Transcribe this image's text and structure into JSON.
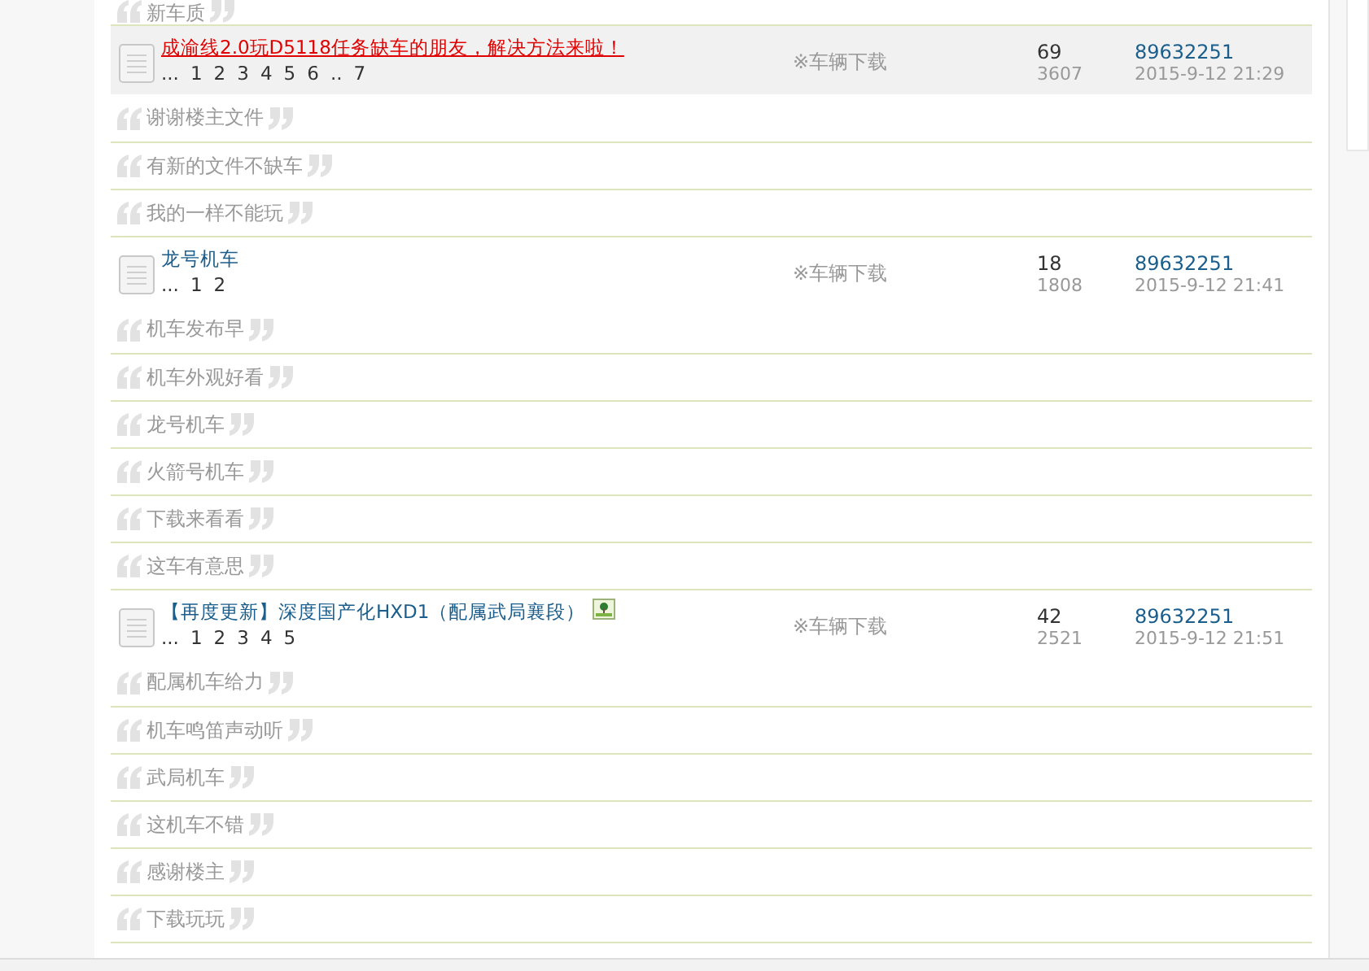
{
  "threads": [
    {
      "kind": "reply-only",
      "replies": [
        "新车质"
      ]
    },
    {
      "kind": "thread",
      "highlighted": true,
      "hot": true,
      "title": "成渝线2.0玩D5118任务缺车的朋友，解决方法来啦！",
      "has_image": false,
      "pages": [
        "...",
        "1",
        "2",
        "3",
        "4",
        "5",
        "6",
        "..",
        "7"
      ],
      "category": "※车辆下载",
      "replies_count": "69",
      "views": "3607",
      "author": "89632251",
      "date": "2015-9-12 21:29",
      "replies": [
        "谢谢楼主文件",
        "有新的文件不缺车",
        "我的一样不能玩"
      ]
    },
    {
      "kind": "thread",
      "highlighted": false,
      "hot": false,
      "title": "龙号机车",
      "has_image": false,
      "pages": [
        "...",
        "1",
        "2"
      ],
      "category": "※车辆下载",
      "replies_count": "18",
      "views": "1808",
      "author": "89632251",
      "date": "2015-9-12 21:41",
      "replies": [
        "机车发布早",
        "机车外观好看",
        "龙号机车",
        "火箭号机车",
        "下载来看看",
        "这车有意思"
      ]
    },
    {
      "kind": "thread",
      "highlighted": false,
      "hot": false,
      "prefix": "【再度更新】",
      "title": "深度国产化HXD1（配属武局襄段）",
      "has_image": true,
      "pages": [
        "...",
        "1",
        "2",
        "3",
        "4",
        "5"
      ],
      "category": "※车辆下载",
      "replies_count": "42",
      "views": "2521",
      "author": "89632251",
      "date": "2015-9-12 21:51",
      "replies": [
        "配属机车给力",
        "机车鸣笛声动听",
        "武局机车",
        "这机车不错",
        "感谢楼主",
        "下载玩玩"
      ]
    }
  ]
}
